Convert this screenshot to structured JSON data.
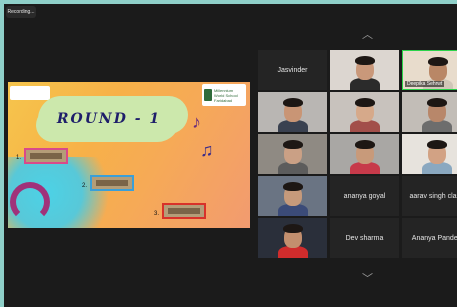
{
  "recording": {
    "label": "Recording..."
  },
  "slide": {
    "title": "ROUND - 1",
    "school_logo": [
      "Millennium",
      "World School",
      "Faridabad"
    ],
    "clues": [
      {
        "number": "1.",
        "color": "#d94a8a"
      },
      {
        "number": "2.",
        "color": "#3a9fd8"
      },
      {
        "number": "3.",
        "color": "#d8322a"
      }
    ]
  },
  "participants": [
    {
      "name": "Jasvinder",
      "video": false
    },
    {
      "name": "",
      "video": true,
      "skin": "#c9987a",
      "bg": "#dcd6d0",
      "shirt": "#2b2b2b"
    },
    {
      "name": "Deepika Sehrwt",
      "video": true,
      "skin": "#b98766",
      "bg": "#e8dccc",
      "shirt": "#d0c6b8",
      "active": true
    },
    {
      "name": "",
      "video": true,
      "skin": "#c99575",
      "bg": "#b9b6b3",
      "shirt": "#3a4150"
    },
    {
      "name": "",
      "video": true,
      "skin": "#d6a98a",
      "bg": "#c8c2bd",
      "shirt": "#a24f4a"
    },
    {
      "name": "",
      "video": true,
      "skin": "#b8876a",
      "bg": "#c2bdb7",
      "shirt": "#6d6d6d"
    },
    {
      "name": "",
      "video": true,
      "skin": "#caa085",
      "bg": "#8f8a83",
      "shirt": "#5c5c5c"
    },
    {
      "name": "",
      "video": true,
      "skin": "#c89a7a",
      "bg": "#a9a7a4",
      "shirt": "#c73a4a"
    },
    {
      "name": "",
      "video": true,
      "skin": "#d2a284",
      "bg": "#e7e3dd",
      "shirt": "#8aa8c0"
    },
    {
      "name": "",
      "video": true,
      "skin": "#c69a7b",
      "bg": "#6a7483",
      "shirt": "#3b4b78"
    },
    {
      "name": "ananya goyal",
      "video": false
    },
    {
      "name": "aarav singh class",
      "video": false
    },
    {
      "name": "",
      "video": true,
      "skin": "#c38f6e",
      "bg": "#2a2f3a",
      "shirt": "#d02c2c"
    },
    {
      "name": "Dev sharma",
      "video": false
    },
    {
      "name": "Ananya Pandey",
      "video": false
    }
  ],
  "icons": {
    "scroll_up": "chevron-up-icon",
    "scroll_down": "chevron-down-icon"
  },
  "colors": {
    "frame": "#8fd0c9",
    "active_speaker": "#2bd34a"
  }
}
